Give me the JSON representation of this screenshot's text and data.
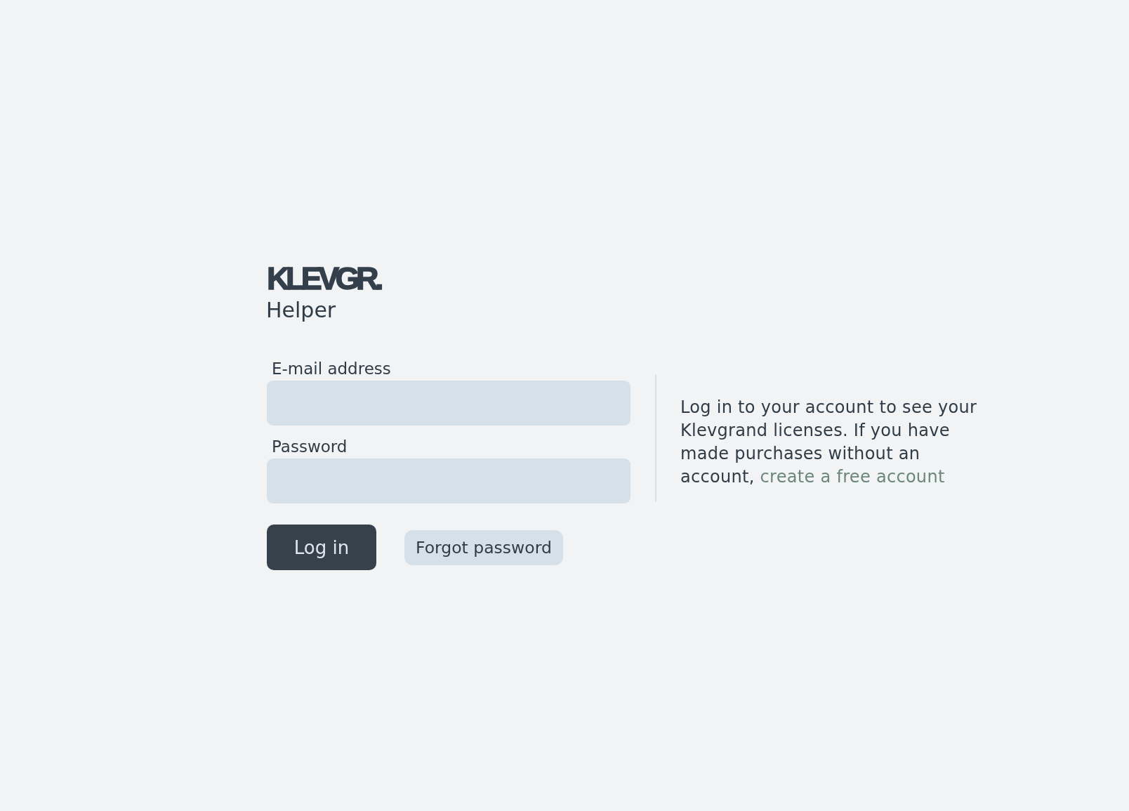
{
  "logo": "KLEVGR.",
  "app_name": "Helper",
  "form": {
    "fields": [
      {
        "label": "E-mail address"
      },
      {
        "label": "Password"
      }
    ],
    "buttons": [
      {
        "label": "Log in",
        "kind": "primary"
      },
      {
        "label": "Forgot password",
        "kind": "secondary"
      }
    ]
  },
  "info": {
    "text": "Log in to your account to see your Klevgrand licenses. If you have made purchases without an account,",
    "link": "create a free account"
  }
}
